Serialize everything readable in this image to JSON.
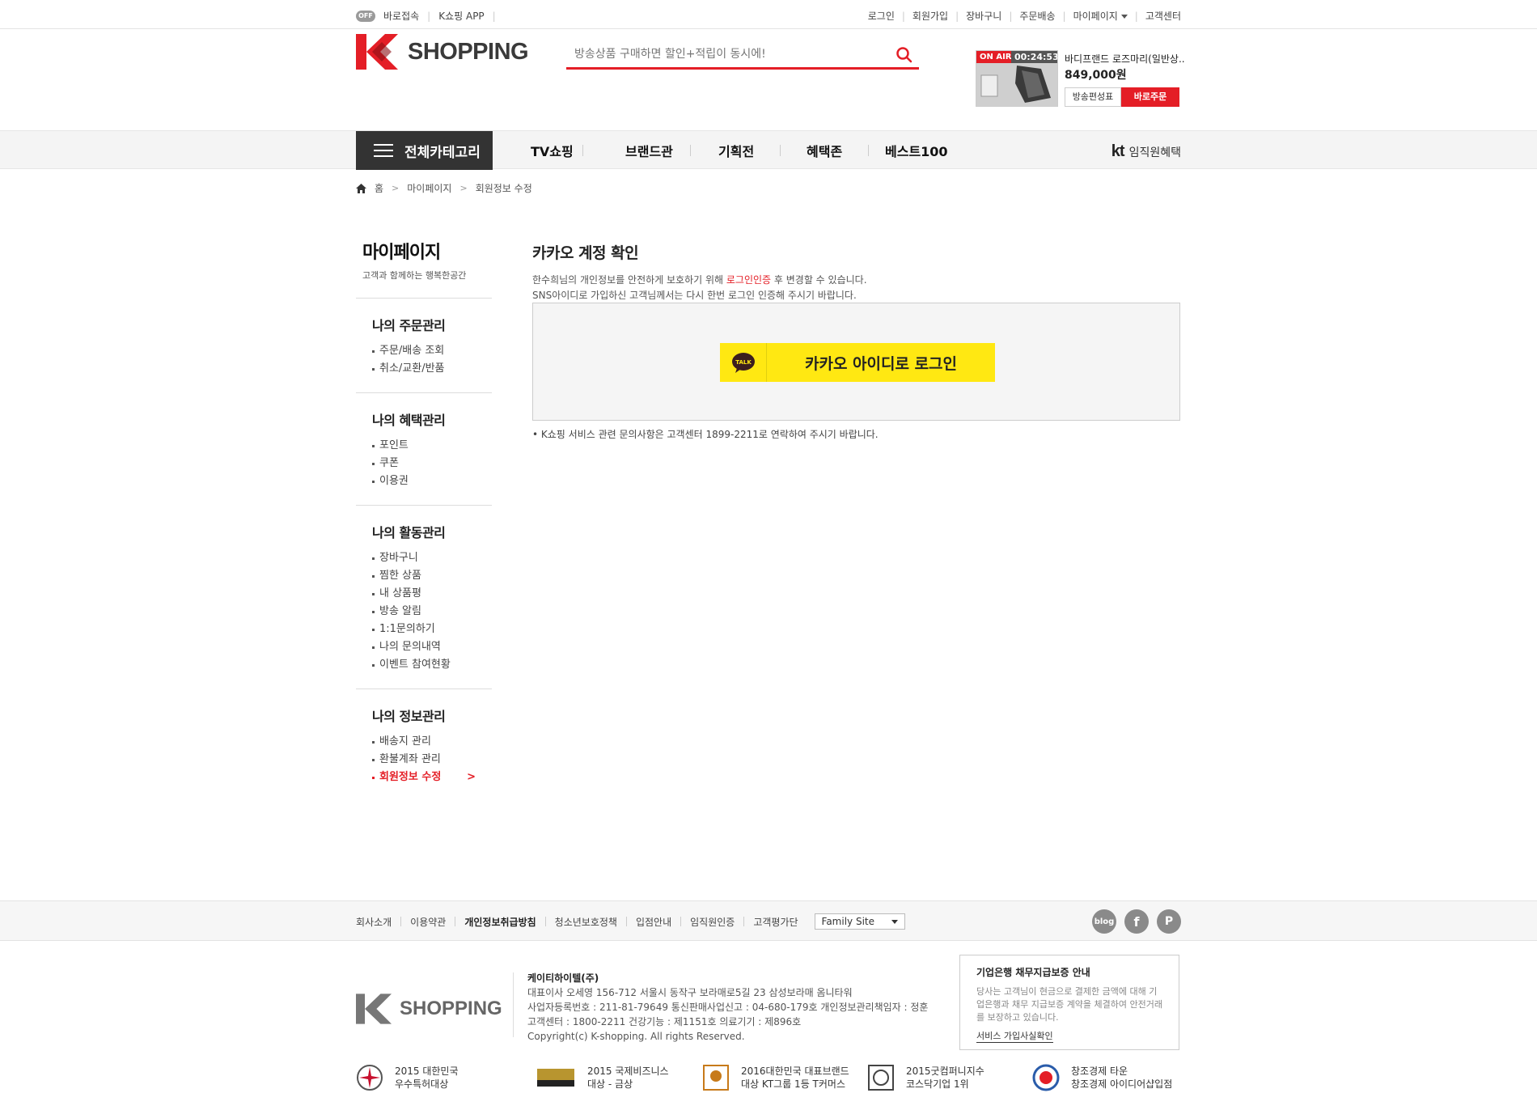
{
  "topbar": {
    "shortcut_toggle": "OFF",
    "shortcut_label": "바로접속",
    "app_label": "K쇼핑 APP",
    "links": [
      "로그인",
      "회원가입",
      "장바구니",
      "주문배송",
      "마이페이지",
      "고객센터"
    ]
  },
  "logo": {
    "text": "SHOPPING"
  },
  "search": {
    "placeholder": "방송상품 구매하면 할인+적립이 동시에!"
  },
  "onair": {
    "badge": "ON AIR",
    "timer": "00:24:53",
    "title": "바디프랜드 로즈마리(일반상..",
    "price": "849,000원",
    "schedule_btn": "방송편성표",
    "order_btn": "바로주문"
  },
  "gnb": {
    "all_category": "전체카테고리",
    "menu": [
      "TV쇼핑",
      "브랜드관",
      "기획전",
      "혜택존",
      "베스트100"
    ],
    "kt_label": "임직원혜택",
    "kt_logo": "kt"
  },
  "breadcrumb": [
    "홈",
    "마이페이지",
    "회원정보 수정"
  ],
  "sidebar": {
    "title": "마이페이지",
    "subtitle": "고객과 함께하는 행복한공간",
    "groups": [
      {
        "title": "나의 주문관리",
        "items": [
          "주문/배송 조회",
          "취소/교환/반품"
        ]
      },
      {
        "title": "나의 혜택관리",
        "items": [
          "포인트",
          "쿠폰",
          "이용권"
        ]
      },
      {
        "title": "나의 활동관리",
        "items": [
          "장바구니",
          "찜한 상품",
          "내 상품평",
          "방송 알림",
          "1:1문의하기",
          "나의 문의내역",
          "이벤트 참여현황"
        ]
      },
      {
        "title": "나의 정보관리",
        "items": [
          "배송지 관리",
          "환불계좌 관리",
          "회원정보 수정"
        ]
      }
    ]
  },
  "main": {
    "title": "카카오 계정 확인",
    "desc1_pre": "한수희님의 개인정보를 안전하게 보호하기 위해 ",
    "desc1_red": "로그인인증",
    "desc1_post": " 후 변경할 수 있습니다.",
    "desc2": "SNS아이디로 가입하신 고객님께서는 다시 한번 로그인 인증해 주시기 바랍니다.",
    "kakao_talk": "TALK",
    "kakao_btn": "카카오 아이디로 로그인",
    "note": "• K쇼핑 서비스 관련 문의사항은 고객센터 1899-2211로 연락하여 주시기 바랍니다."
  },
  "footer": {
    "links": [
      "회사소개",
      "이용약관",
      "개인정보취급방침",
      "청소년보호정책",
      "입점안내",
      "임직원인증",
      "고객평가단"
    ],
    "family_site": "Family Site",
    "sns": [
      "blog",
      "f",
      "P"
    ],
    "company": "케이티하이텔(주)",
    "info_lines": [
      "대표이사 오세영 156-712 서울시 동작구 보라매로5길 23 삼성보라매 옴니타워",
      "사업자등록번호 : 211-81-79649 통신판매사업신고 : 04-680-179호 개인정보관리책임자 : 정훈",
      "고객센터 : 1800-2211 건강기능 : 제1151호 의료기기 : 제896호",
      "Copyright(c) K-shopping. All rights Reserved."
    ],
    "guarantee": {
      "title": "기업은행 채무지급보증 안내",
      "body": "당사는 고객님이 현금으로 결제한 금액에 대해 기업은행과 채무 지급보증 계약을 체결하여 안전거래를 보장하고 있습니다.",
      "link": "서비스 가입사실확인"
    },
    "awards": [
      {
        "l1": "2015 대한민국",
        "l2": "우수특허대상"
      },
      {
        "l1": "2015 국제비즈니스",
        "l2": "대상 - 금상"
      },
      {
        "l1": "2016대한민국 대표브랜드",
        "l2": "대상 KT그룹 1등 T커머스"
      },
      {
        "l1": "2015굿컴퍼니지수",
        "l2": "코스닥기업 1위"
      },
      {
        "l1": "창조경제 타운",
        "l2": "창조경제 아이디어샵입점"
      }
    ]
  },
  "colors": {
    "accent": "#e41e26",
    "kakao": "#ffe812",
    "dark": "#333333"
  }
}
